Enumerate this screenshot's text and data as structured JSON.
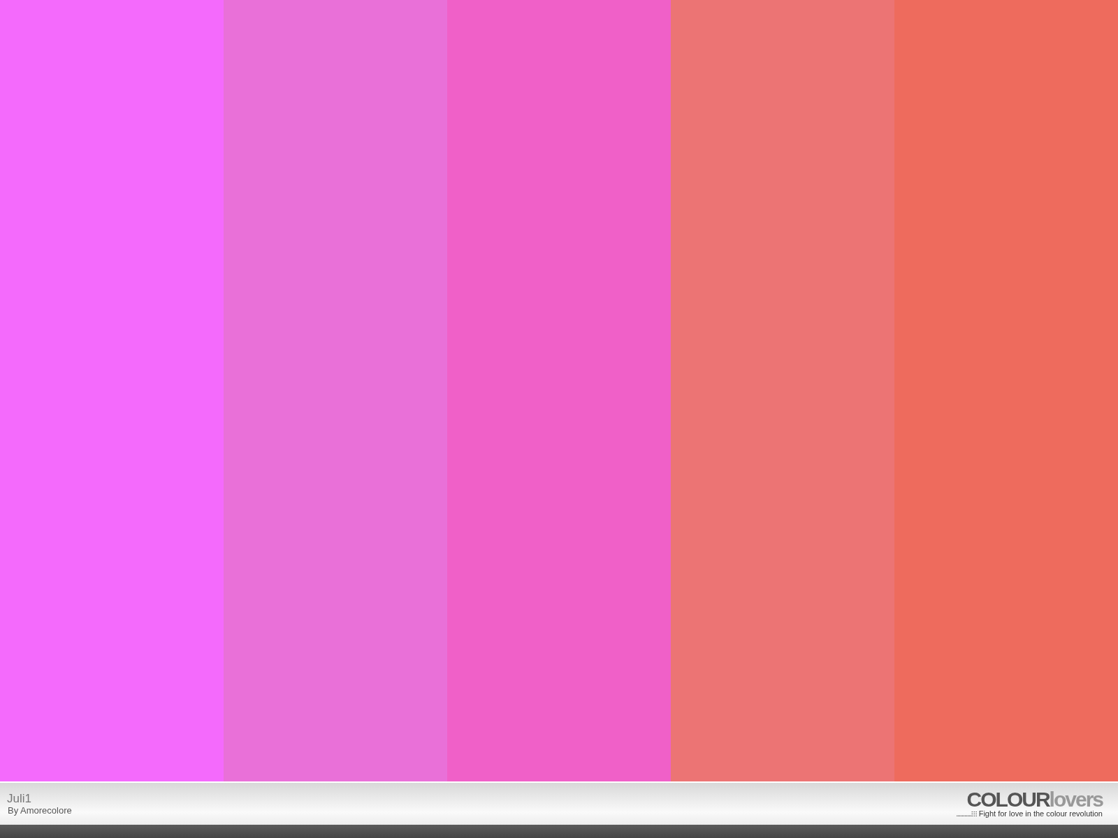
{
  "swatches": [
    {
      "color": "#f46afc"
    },
    {
      "color": "#e970d8"
    },
    {
      "color": "#f060c8"
    },
    {
      "color": "#ec7474"
    },
    {
      "color": "#ee6b5d"
    }
  ],
  "footer": {
    "palette_title": "Juli1",
    "author": "By Amorecolore",
    "logo": "**COLOUR**lovers",
    "tagline": "Fight for love in the colour revolution"
  }
}
